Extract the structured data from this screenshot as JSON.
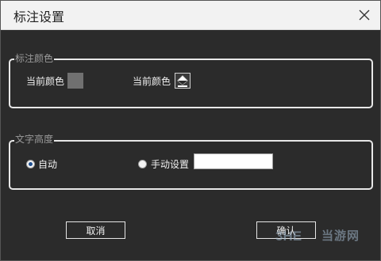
{
  "window": {
    "title": "标注设置"
  },
  "annotation_color": {
    "group_label": "标注颜色",
    "current_color_label_1": "当前颜色",
    "current_color_label_2": "当前颜色",
    "swatch_color": "#707070"
  },
  "text_height": {
    "group_label": "文字高度",
    "auto_label": "自动",
    "manual_label": "手动设置",
    "selected": "auto",
    "manual_value": ""
  },
  "buttons": {
    "cancel": "取消",
    "ok": "确认"
  },
  "watermark": {
    "text": "当游网"
  }
}
